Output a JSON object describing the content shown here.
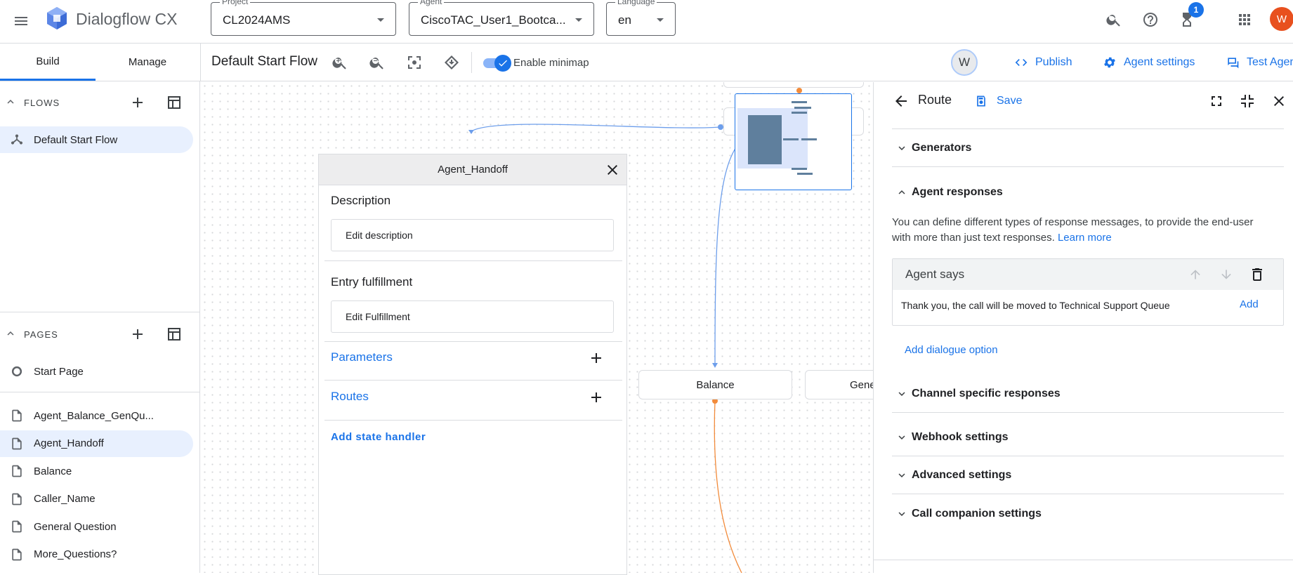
{
  "app": {
    "name": "Dialogflow CX",
    "menu_icon": "hamburger-menu-icon",
    "logo_icon": "dialogflow-cube-logo"
  },
  "header": {
    "project": {
      "label": "Project",
      "value": "CL2024AMS"
    },
    "agent": {
      "label": "Agent",
      "value": "CiscoTAC_User1_Bootca..."
    },
    "language": {
      "label": "Language",
      "value": "en"
    },
    "notification_count": "1",
    "avatar_letter": "W",
    "icons": [
      "search-icon",
      "help-icon",
      "hourglass-icon",
      "apps-grid-icon"
    ]
  },
  "tabs": [
    {
      "label": "Build",
      "active": true
    },
    {
      "label": "Manage",
      "active": false
    }
  ],
  "toolbar": {
    "flow_title": "Default Start Flow",
    "minimap_label": "Enable minimap",
    "minimap_enabled": true,
    "collaborator_letter": "W",
    "publish": "Publish",
    "agent_settings": "Agent settings",
    "test_agent": "Test Agent"
  },
  "sidebar": {
    "flows_header": "FLOWS",
    "flows": [
      {
        "label": "Default Start Flow",
        "selected": true
      }
    ],
    "pages_header": "PAGES",
    "start_page": "Start Page",
    "pages": [
      {
        "label": "Agent_Balance_GenQu...",
        "selected": false
      },
      {
        "label": "Agent_Handoff",
        "selected": true
      },
      {
        "label": "Balance",
        "selected": false
      },
      {
        "label": "Caller_Name",
        "selected": false
      },
      {
        "label": "General Question",
        "selected": false
      },
      {
        "label": "More_Questions?",
        "selected": false
      }
    ]
  },
  "page_panel": {
    "title": "Agent_Handoff",
    "description_label": "Description",
    "description_placeholder": "Edit description",
    "entry_label": "Entry fulfillment",
    "entry_placeholder": "Edit Fulfillment",
    "parameters": "Parameters",
    "routes": "Routes",
    "add_state_handler": "Add state handler"
  },
  "canvas_nodes": {
    "balance": "Balance",
    "general": "Gene"
  },
  "route_panel": {
    "title": "Route",
    "save": "Save",
    "generators": "Generators",
    "agent_responses": "Agent responses",
    "description": "You can define different types of response messages, to provide the end-user with more than just text responses.",
    "learn_more": "Learn more",
    "agent_says_title": "Agent says",
    "agent_says_text": "Thank you, the call will be moved to Technical Support Queue",
    "add": "Add",
    "add_dialogue_option": "Add dialogue option",
    "sections": [
      "Channel specific responses",
      "Webhook settings",
      "Advanced settings",
      "Call companion settings"
    ]
  },
  "colors": {
    "accent": "#1a73e8",
    "selected_bg": "#e8f0fe",
    "avatar": "#e8501e",
    "edge_blue": "#6d9eeb",
    "edge_orange": "#f28b3b"
  }
}
